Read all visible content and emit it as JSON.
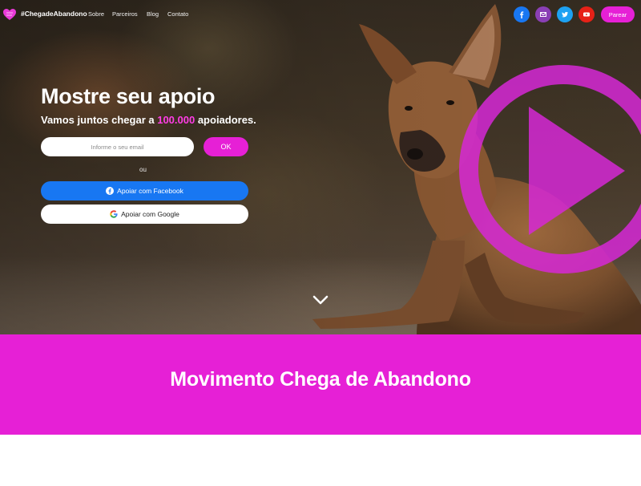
{
  "nav": {
    "brand": "#ChegadeAbandono",
    "links": [
      "Sobre",
      "Parceiros",
      "Blog",
      "Contato"
    ],
    "cta_label": "Parear"
  },
  "social": [
    {
      "name": "facebook",
      "icon": "facebook-icon",
      "color": "#1877f2"
    },
    {
      "name": "email",
      "icon": "email-icon",
      "color": "#8a3fb5"
    },
    {
      "name": "twitter",
      "icon": "twitter-icon",
      "color": "#1da1f2"
    },
    {
      "name": "youtube",
      "icon": "youtube-icon",
      "color": "#e62117"
    }
  ],
  "hero": {
    "title": "Mostre seu apoio",
    "subtitle_pre": "Vamos juntos chegar a ",
    "subtitle_highlight": "100.000",
    "subtitle_post": " apoiadores.",
    "email_placeholder": "Informe o seu email",
    "ok_label": "OK",
    "or_label": "ou",
    "facebook_label": "Apoiar com Facebook",
    "google_label": "Apoiar com Google"
  },
  "band": {
    "title": "Movimento Chega de Abandono"
  },
  "colors": {
    "accent": "#e620d6",
    "highlight": "#ff3de6",
    "facebook": "#1877f2"
  }
}
